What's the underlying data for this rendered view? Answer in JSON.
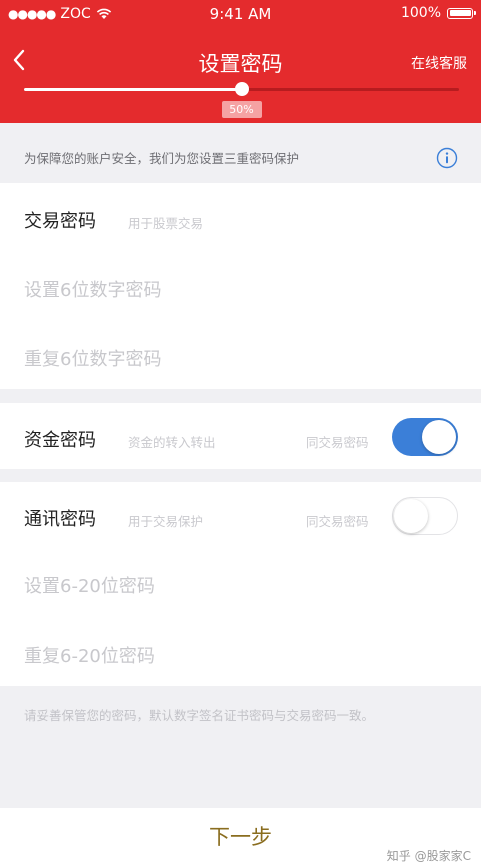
{
  "status_bar": {
    "carrier": "ZOC",
    "time": "9:41 AM",
    "battery": "100%"
  },
  "nav": {
    "title": "设置密码",
    "right_link": "在线客服"
  },
  "progress": {
    "percent": 50,
    "label": "50%"
  },
  "notice": {
    "text": "为保障您的账户安全，我们为您设置三重密码保护"
  },
  "trade_password": {
    "title": "交易密码",
    "desc": "用于股票交易",
    "field1_placeholder": "设置6位数字密码",
    "field2_placeholder": "重复6位数字密码"
  },
  "fund_password": {
    "title": "资金密码",
    "desc": "资金的转入转出",
    "same_label": "同交易密码",
    "same_as_trade": true
  },
  "comm_password": {
    "title": "通讯密码",
    "desc": "用于交易保护",
    "same_label": "同交易密码",
    "same_as_trade": false,
    "field1_placeholder": "设置6-20位密码",
    "field2_placeholder": "重复6-20位密码"
  },
  "footer_note": "请妥善保管您的密码，默认数字签名证书密码与交易密码一致。",
  "next_button": "下一步",
  "watermark": "知乎 @股家家C",
  "colors": {
    "brand_red": "#e42b2d",
    "toggle_blue": "#3b7fd8"
  }
}
